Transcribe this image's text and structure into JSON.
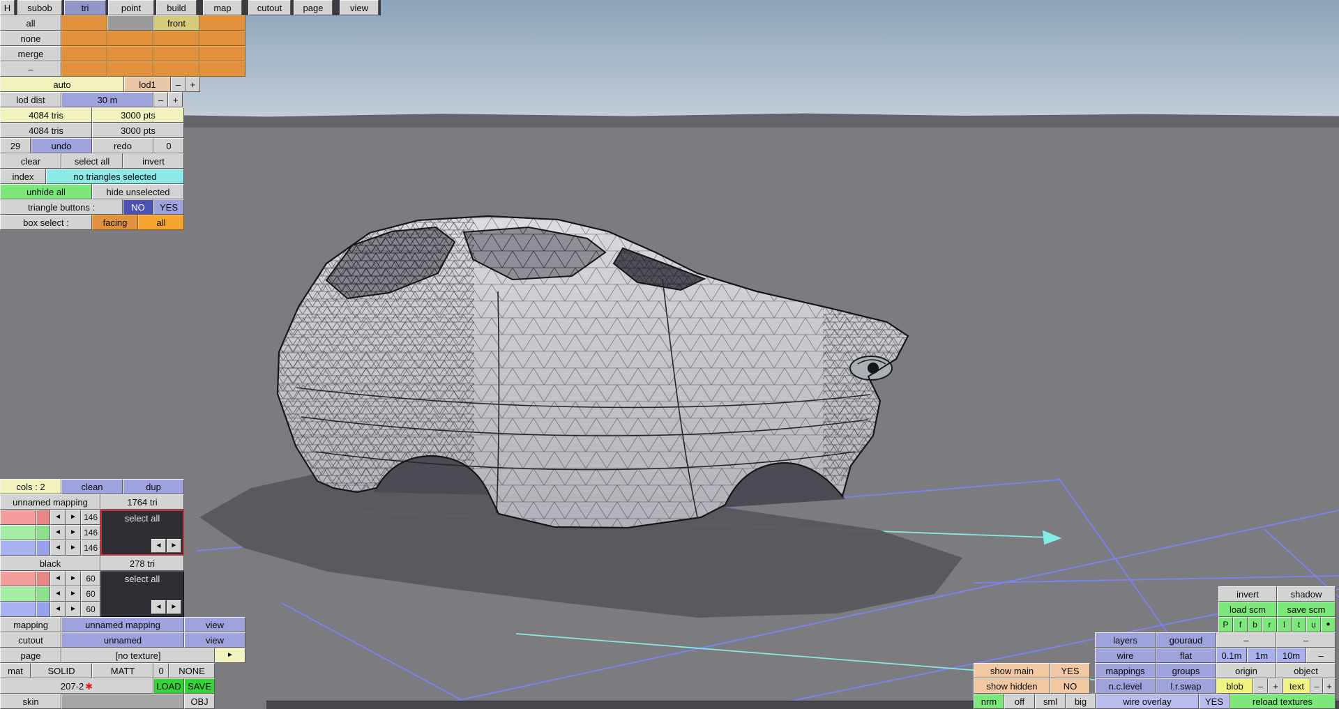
{
  "menu": {
    "h": "H",
    "tabs": [
      {
        "label": "subob"
      },
      {
        "label": "tri"
      },
      {
        "label": "point"
      },
      {
        "label": "build"
      },
      {
        "label": "map"
      },
      {
        "label": "cutout"
      },
      {
        "label": "page"
      },
      {
        "label": "view"
      }
    ],
    "active_tab": "tri"
  },
  "subobject_grid": {
    "rows": [
      "all",
      "none",
      "merge",
      "–"
    ],
    "front": "front"
  },
  "lod": {
    "auto": "auto",
    "lod1": "lod1",
    "minus": "–",
    "plus": "+",
    "dist_label": "lod dist",
    "dist_value": "30 m",
    "active_tris": "4084 tris",
    "active_pts": "3000 pts",
    "total_tris": "4084 tris",
    "total_pts": "3000 pts"
  },
  "history": {
    "undo_count": "29",
    "undo": "undo",
    "redo": "redo",
    "redo_count": "0"
  },
  "tri_tools": {
    "clear": "clear",
    "select_all": "select all",
    "invert": "invert",
    "index": "index",
    "selection_status": "no triangles selected",
    "unhide_all": "unhide all",
    "hide_unselected": "hide unselected",
    "triangle_buttons_label": "triangle buttons :",
    "no": "NO",
    "yes": "YES",
    "box_select_label": "box select :",
    "facing": "facing",
    "all": "all"
  },
  "mapping_panel": {
    "cols": "cols : 2",
    "clean": "clean",
    "dup": "dup",
    "arrow_left": "◄",
    "arrow_right": "►",
    "groups": [
      {
        "name": "unnamed mapping",
        "tris": "1764 tri",
        "select_all": "select all",
        "counts": [
          "146",
          "146",
          "146"
        ]
      },
      {
        "name": "black",
        "tris": "278 tri",
        "select_all": "select all",
        "counts": [
          "60",
          "60",
          "60"
        ]
      }
    ],
    "mapping_label": "mapping",
    "mapping_value": "unnamed mapping",
    "mapping_view": "view",
    "cutout_label": "cutout",
    "cutout_value": "unnamed",
    "cutout_view": "view",
    "page_label": "page",
    "page_value": "[no texture]",
    "page_browse": "►",
    "mat_label": "mat",
    "shading": "SOLID",
    "material": "MATT",
    "mat_num": "0",
    "mat_tex": "NONE",
    "file_name": "207-2",
    "file_flag": "✱",
    "load": "LOAD",
    "save": "SAVE",
    "skin": "skin",
    "obj": "OBJ"
  },
  "view_panel": {
    "invert": "invert",
    "shadow": "shadow",
    "load_scm": "load scm",
    "save_scm": "save scm",
    "cam_buttons": [
      "P",
      "f",
      "b",
      "r",
      "l",
      "t",
      "u",
      "●"
    ],
    "layers": "layers",
    "gouraud": "gouraud",
    "layers_dash1": "–",
    "layers_dash2": "–",
    "wire": "wire",
    "flat": "flat",
    "grid_01": "0.1m",
    "grid_1": "1m",
    "grid_10": "10m",
    "grid_dash": "–",
    "show_main": "show main",
    "show_main_val": "YES",
    "mappings": "mappings",
    "groups": "groups",
    "origin": "origin",
    "object": "object",
    "show_hidden": "show hidden",
    "show_hidden_val": "NO",
    "nc_level": "n.c.level",
    "lr_swap": "l.r.swap",
    "blob": "blob",
    "blob_minus": "–",
    "blob_plus": "+",
    "text": "text",
    "text_minus": "–",
    "text_plus": "+",
    "nrm": "nrm",
    "off": "off",
    "sml": "sml",
    "big": "big",
    "wire_overlay": "wire overlay",
    "wire_overlay_val": "YES",
    "reload_textures": "reload textures"
  },
  "colors": {
    "selected_tab": "#9296c9",
    "button_purple": "#9fa3dd",
    "button_cyan": "#8ce9e5",
    "button_green": "#7ce87c",
    "button_green_bright": "#35d435",
    "button_orange": "#e2913c",
    "button_orange_bright": "#f5a52e",
    "button_peach": "#f2c8a2",
    "no_toggle_blue": "#4b52b4",
    "swatch_red": "#f59d9d",
    "swatch_green": "#a4eda4",
    "swatch_blue": "#aab3f2",
    "grid_line_blue": "#7b85f2",
    "axis_cyan": "#84ece6"
  }
}
